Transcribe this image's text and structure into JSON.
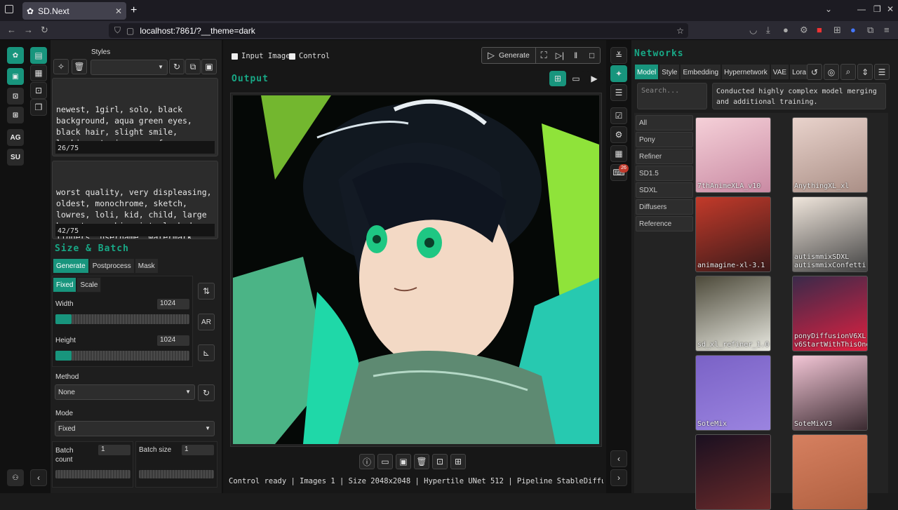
{
  "browser": {
    "tab_title": "SD.Next",
    "url": "localhost:7861/?__theme=dark"
  },
  "rail": {
    "ag_label": "AG",
    "su_label": "SU"
  },
  "styles": {
    "label": "Styles",
    "selected": ""
  },
  "prompt": {
    "positive": "newest, 1girl, solo, black background, aqua green eyes, black hair, slight smile, looking at viewer, safe,",
    "positive_count": "26/75",
    "negative": "worst quality, very displeasing, oldest, monochrome, sketch, lowres, loli, kid, child, large breasts, zombie, interlocked fingers, username, watermark, heterochromia,",
    "negative_count": "42/75"
  },
  "size_batch": {
    "title": "Size & Batch",
    "tabs": [
      "Generate",
      "Postprocess",
      "Mask"
    ],
    "subtabs": [
      "Fixed",
      "Scale"
    ],
    "width_label": "Width",
    "width_value": "1024",
    "width_fraction": 0.12,
    "height_label": "Height",
    "height_value": "1024",
    "height_fraction": 0.12,
    "ar_label": "AR",
    "method_label": "Method",
    "method_value": "None",
    "mode_label": "Mode",
    "mode_value": "Fixed",
    "batch_count_label": "Batch count",
    "batch_count_value": "1",
    "batch_size_label": "Batch size",
    "batch_size_value": "1"
  },
  "center": {
    "input_image_label": "Input Image",
    "control_label": "Control",
    "generate_label": "Generate",
    "output_label": "Output",
    "status": "Control ready | Images 1 | Size 2048x2048 | Hypertile UNet 512 | Pipeline StableDiffusionXLPipeline"
  },
  "right_rail": {
    "badge": "26"
  },
  "networks": {
    "title": "Networks",
    "tabs": [
      "Model",
      "Style",
      "Embedding",
      "Hypernetwork",
      "VAE",
      "Lora"
    ],
    "search_placeholder": "Search...",
    "description": "Conducted highly complex model merging and additional training.",
    "categories": [
      "All",
      "Pony",
      "Refiner",
      "SD1.5",
      "SDXL",
      "Diffusers",
      "Reference"
    ],
    "cards": [
      {
        "label": "7thAnimeXLA_v10"
      },
      {
        "label": "AnythingXL_xl"
      },
      {
        "label": "animagine-xl-3.1"
      },
      {
        "label": "autismmixSDXL autismmixConfetti"
      },
      {
        "label": "sd_xl_refiner_1.0"
      },
      {
        "label": "ponyDiffusionV6XL v6StartWithThisOne"
      },
      {
        "label": "SoteMix"
      },
      {
        "label": "SoteMixV3"
      },
      {
        "label": ""
      },
      {
        "label": ""
      }
    ]
  },
  "colors": {
    "accent": "#18957d",
    "accent_text": "#18a886"
  }
}
